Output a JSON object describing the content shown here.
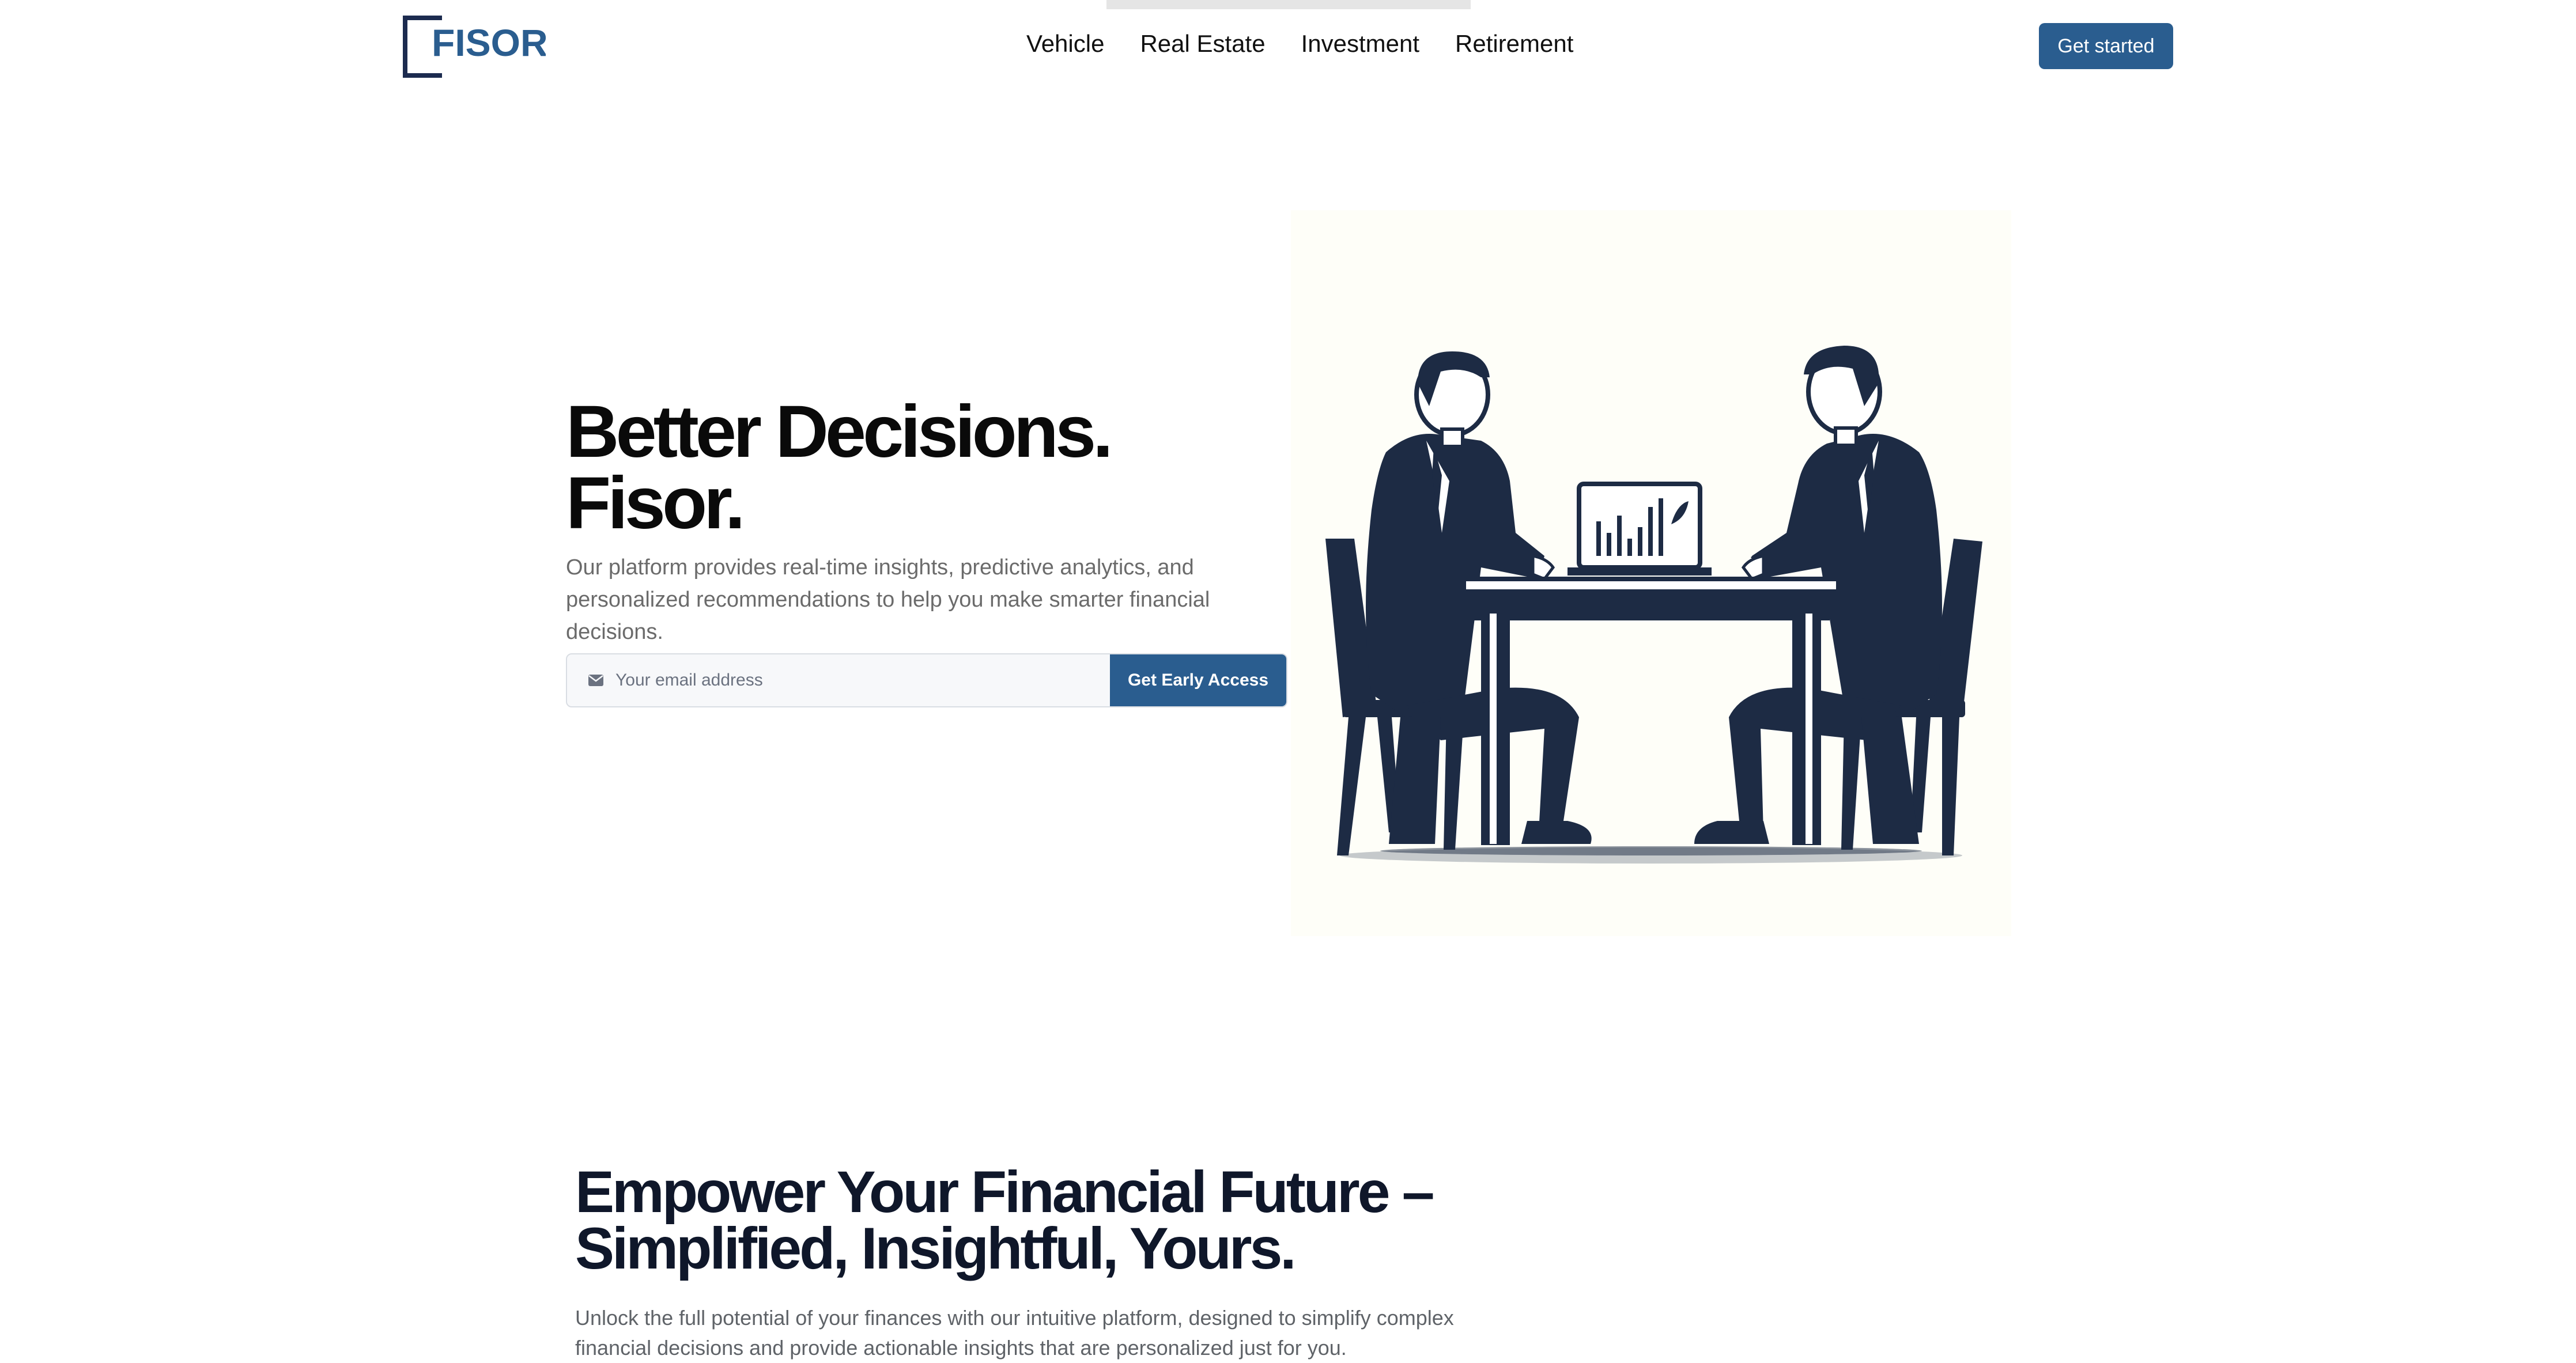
{
  "header": {
    "logo_text": "FISOR",
    "nav": [
      "Vehicle",
      "Real Estate",
      "Investment",
      "Retirement"
    ],
    "cta_label": "Get started"
  },
  "hero": {
    "title_line1": "Better Decisions.",
    "title_line2": "Fisor.",
    "description": "Our platform provides real-time insights, predictive analytics, and personalized recommendations to help you make smarter financial decisions.",
    "email_placeholder": "Your email address",
    "email_icon": "mail-icon",
    "submit_label": "Get Early Access",
    "illustration": "two-businessmen-at-table-illustration"
  },
  "section2": {
    "title_line1": "Empower Your Financial Future –",
    "title_line2": "Simplified, Insightful, Yours.",
    "description": "Unlock the full potential of your finances with our intuitive platform, designed to simplify complex financial decisions and provide actionable insights that are personalized just for you."
  },
  "colors": {
    "brand": "#2a5d8f",
    "logo_navy": "#1c2b4f",
    "illustration_navy": "#1d2b44",
    "text_dark": "#0a0a0a",
    "text_muted": "#6b6b6b"
  }
}
